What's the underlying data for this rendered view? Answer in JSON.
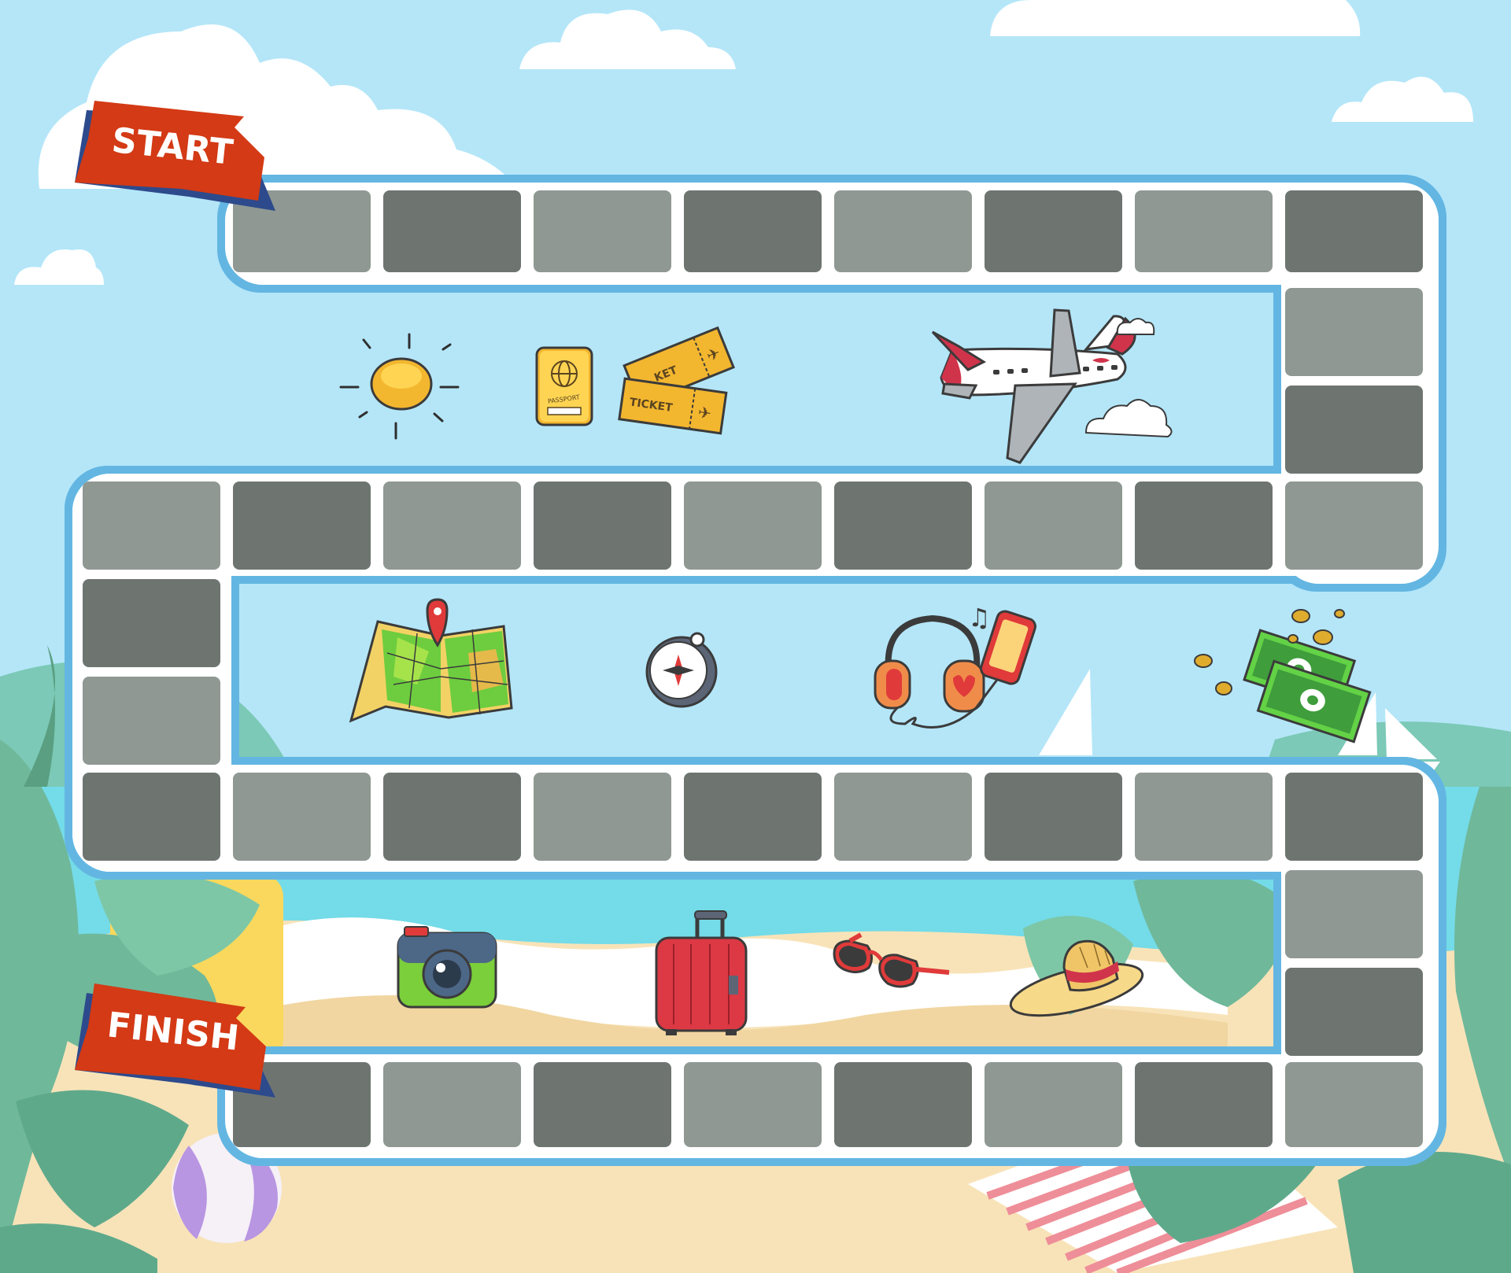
{
  "game": {
    "start_label": "START",
    "finish_label": "FINISH",
    "items": {
      "passport_text": "PASSPORT",
      "ticket_text": "TICKET",
      "ticket_back_text": "KET"
    }
  },
  "colors": {
    "sky": "#b4e6f8",
    "cloud": "#ffffff",
    "board_border": "#63b6e2",
    "tile_light": "#8f9892",
    "tile_dark": "#6e7571",
    "tile_gap": "#ffffff",
    "banner": "#d33a15",
    "banner_stripe": "#2d4a8c",
    "sea": "#74dbe8",
    "sand": "#f8e3b8",
    "foliage": "#6fb89a"
  }
}
